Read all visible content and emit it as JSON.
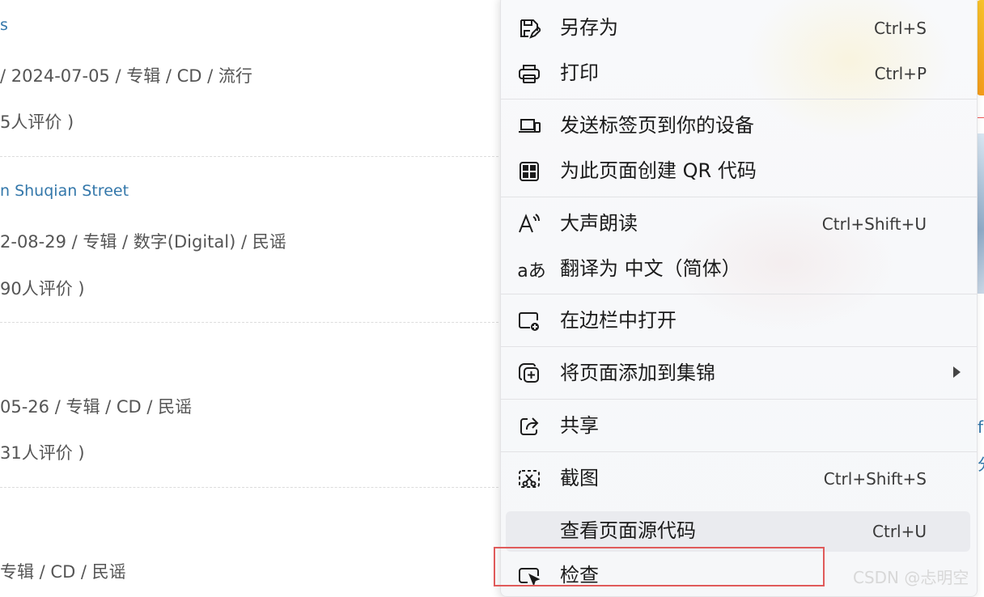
{
  "background": {
    "items": [
      {
        "title": "s",
        "meta": "/ 2024-07-05 / 专辑 / CD / 流行",
        "rating": "5人评价 )"
      },
      {
        "title": "n Shuqian Street",
        "meta": "2-08-29 / 专辑 / 数字(Digital) / 民谣",
        "rating": "90人评价 )"
      },
      {
        "title": "",
        "meta": "05-26 / 专辑 / CD / 民谣",
        "rating": "31人评价 )"
      },
      {
        "title": "",
        "meta": "专辑 / CD / 民谣",
        "rating": ""
      }
    ],
    "edge_glyphs": [
      "f",
      "分"
    ]
  },
  "menu": {
    "items": [
      {
        "label": "另存为",
        "shortcut": "Ctrl+S",
        "icon": "save-icon"
      },
      {
        "label": "打印",
        "shortcut": "Ctrl+P",
        "icon": "print-icon"
      },
      {
        "label": "发送标签页到你的设备",
        "shortcut": "",
        "icon": "send-to-device-icon"
      },
      {
        "label": "为此页面创建 QR 代码",
        "shortcut": "",
        "icon": "qr-code-icon"
      },
      {
        "label": "大声朗读",
        "shortcut": "Ctrl+Shift+U",
        "icon": "read-aloud-icon"
      },
      {
        "label": "翻译为 中文（简体）",
        "shortcut": "",
        "icon": "translate-icon",
        "icon_text": "aあ"
      },
      {
        "label": "在边栏中打开",
        "shortcut": "",
        "icon": "open-in-sidebar-icon"
      },
      {
        "label": "将页面添加到集锦",
        "shortcut": "",
        "icon": "add-to-collections-icon",
        "has_submenu": true
      },
      {
        "label": "共享",
        "shortcut": "",
        "icon": "share-icon"
      },
      {
        "label": "截图",
        "shortcut": "Ctrl+Shift+S",
        "icon": "screenshot-icon"
      },
      {
        "label": "查看页面源代码",
        "shortcut": "Ctrl+U",
        "icon": "",
        "hovered": true
      },
      {
        "label": "检查",
        "shortcut": "",
        "icon": "inspect-icon",
        "highlighted": true
      }
    ]
  },
  "watermark": "CSDN @忐明空",
  "colors": {
    "link": "#3377aa",
    "highlight_box": "#e05a5a",
    "menu_hover": "#eaebef"
  }
}
